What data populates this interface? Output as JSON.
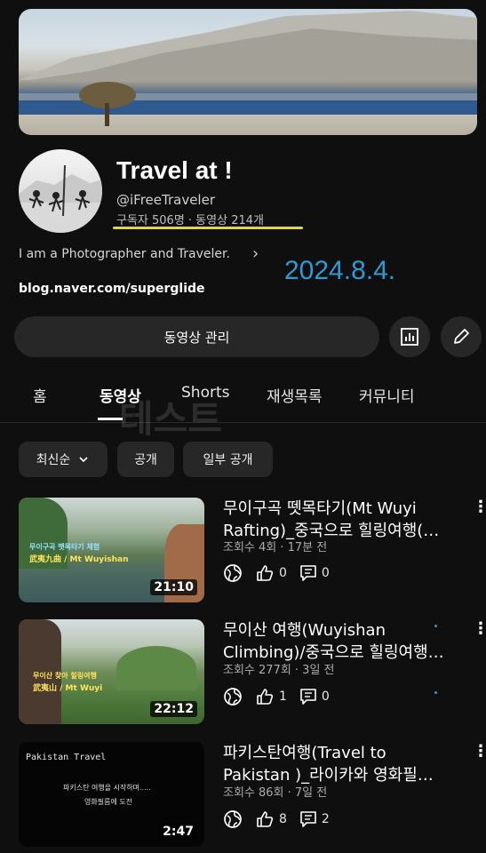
{
  "channel": {
    "title": "Travel at !",
    "handle": "@iFreeTraveler",
    "stats": "구독자 506명 · 동영상 214개",
    "description": "I am a Photographer and Traveler.",
    "link": "blog.naver.com/superglide",
    "annotation_date": "2024.8.4."
  },
  "actions": {
    "manage_label": "동영상 관리"
  },
  "tabs": [
    {
      "label": "홈"
    },
    {
      "label": "동영상"
    },
    {
      "label": "Shorts"
    },
    {
      "label": "재생목록"
    },
    {
      "label": "커뮤니티"
    }
  ],
  "watermark": "테스트",
  "chips": {
    "sort_label": "최신순",
    "public_label": "공개",
    "partial_label": "일부 공개"
  },
  "videos": [
    {
      "title_line1": "무이구곡 뗏목타기(Mt Wuyi",
      "title_line2": "Rafting)_중국으로 힐링여행(…",
      "meta": "조회수 4회 · 17분 전",
      "likes": "0",
      "comments": "0",
      "duration": "21:10",
      "thumb_text1": "무이구곡 뗏목타기 체험",
      "thumb_text2": "武夷九曲 / Mt Wuyishan"
    },
    {
      "title_line1": "무이산 여행(Wuyishan",
      "title_line2": "Climbing)/중국으로 힐링여행…",
      "meta": "조회수 277회 · 3일 전",
      "likes": "1",
      "comments": "0",
      "duration": "22:12",
      "thumb_text1": "무이산 찾아 힐링여행",
      "thumb_text2": "武夷山 / Mt Wuyi"
    },
    {
      "title_line1": "파키스탄여행(Travel to",
      "title_line2": "Pakistan )_라이카와 영화필…",
      "meta": "조회수 86회 · 7일 전",
      "likes": "8",
      "comments": "2",
      "duration": "2:47",
      "thumb_text1": "Pakistan Travel",
      "thumb_text2": "파키스탄 여행을 시작하며.....",
      "thumb_text3": "영화필름에 도전"
    }
  ],
  "colors": {
    "background": "#0f0f0f",
    "button_bg": "#272727",
    "highlight_underline": "#e1d44c",
    "annotation_blue": "#2e9bd6"
  }
}
